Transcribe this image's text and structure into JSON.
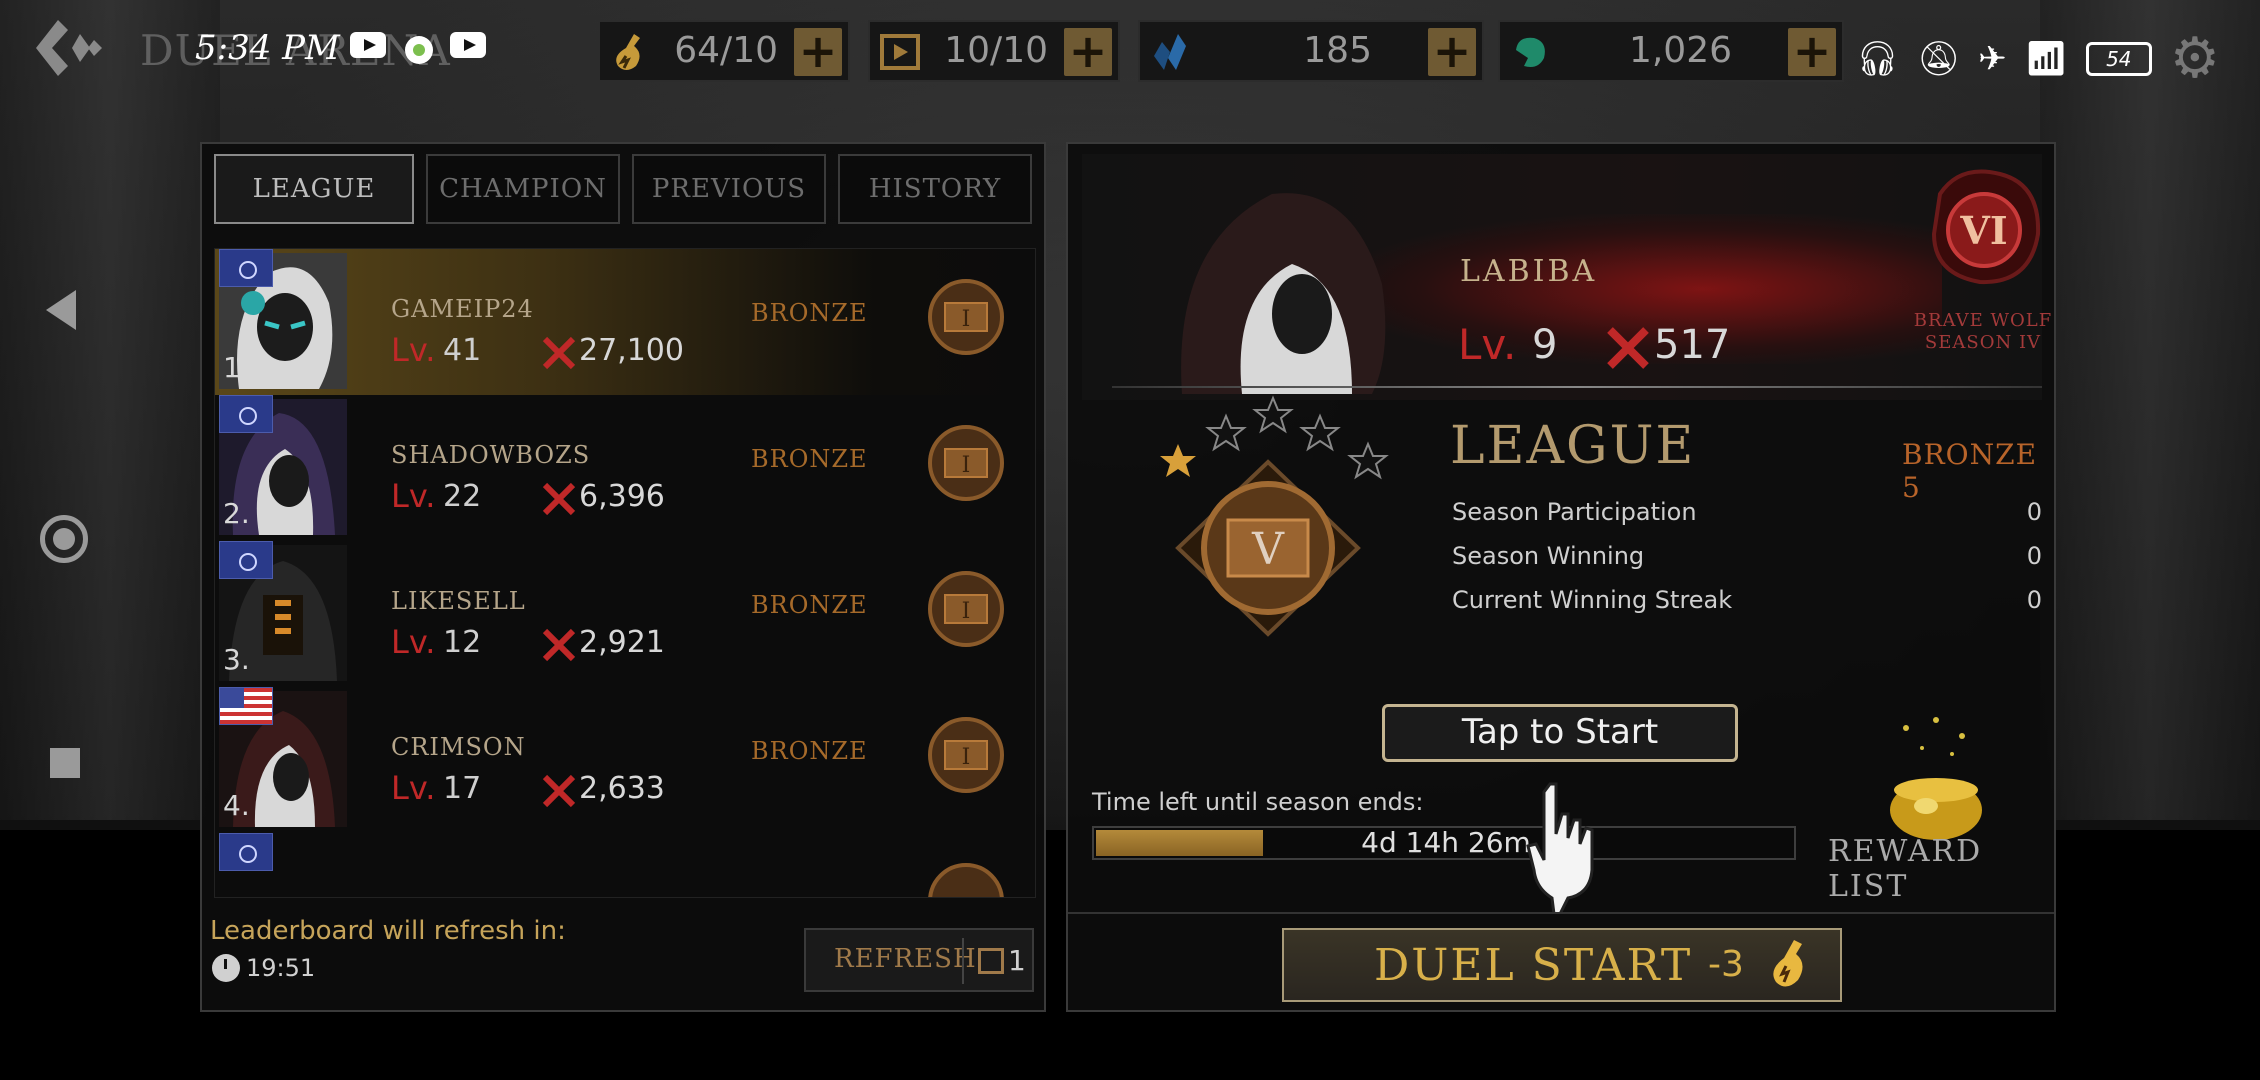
{
  "statusbar": {
    "time": "5:34 PM",
    "battery": "54",
    "game_title_faded": "DUEL ARENA"
  },
  "resources": [
    {
      "icon": "stamina-flask-icon",
      "value": "64/10"
    },
    {
      "icon": "ticket-icon",
      "value": "10/10"
    },
    {
      "icon": "blue-crystal-icon",
      "value": "185"
    },
    {
      "icon": "green-gem-icon",
      "value": "1,026"
    }
  ],
  "tabs": [
    {
      "label": "LEAGUE",
      "active": true
    },
    {
      "label": "CHAMPION",
      "active": false
    },
    {
      "label": "PREVIOUS",
      "active": false
    },
    {
      "label": "HISTORY",
      "active": false
    }
  ],
  "leaderboard": [
    {
      "rank": "1.",
      "name": "GAMEIP24",
      "lv_label": "Lv.",
      "lv": "41",
      "score": "27,100",
      "tier": "BRONZE",
      "flag": "global"
    },
    {
      "rank": "2.",
      "name": "SHADOWBOZS",
      "lv_label": "Lv.",
      "lv": "22",
      "score": "6,396",
      "tier": "BRONZE",
      "flag": "global"
    },
    {
      "rank": "3.",
      "name": "LIKESELL",
      "lv_label": "Lv.",
      "lv": "12",
      "score": "2,921",
      "tier": "BRONZE",
      "flag": "global"
    },
    {
      "rank": "4.",
      "name": "CRIMSON",
      "lv_label": "Lv.",
      "lv": "17",
      "score": "2,633",
      "tier": "BRONZE",
      "flag": "us"
    }
  ],
  "refresh": {
    "text": "Leaderboard will refresh in:",
    "time": "19:51",
    "button_label": "REFRESH",
    "cost": "1"
  },
  "player": {
    "name": "LABIBA",
    "lv_label": "Lv.",
    "lv": "9",
    "score": "517"
  },
  "season": {
    "medal_numeral": "VI",
    "name_line1": "BRAVE WOLF",
    "name_line2": "SEASON IV"
  },
  "league": {
    "title": "LEAGUE",
    "tier": "BRONZE 5",
    "medal_numeral": "V",
    "stars_filled": 1,
    "stars_total": 5,
    "stats": [
      {
        "label": "Season Participation",
        "value": "0"
      },
      {
        "label": "Season Winning",
        "value": "0"
      },
      {
        "label": "Current Winning Streak",
        "value": "0"
      }
    ]
  },
  "tap_to_start": "Tap to Start",
  "season_timer": {
    "label": "Time left until season ends:",
    "value": "4d 14h 26m",
    "progress_fraction": 0.24
  },
  "reward_list": "REWARD LIST",
  "duel": {
    "label": "DUEL START",
    "cost": "-3"
  },
  "colors": {
    "accent_gold": "#d8b04a",
    "bronze": "#a66a2a",
    "level_red": "#c02828"
  }
}
